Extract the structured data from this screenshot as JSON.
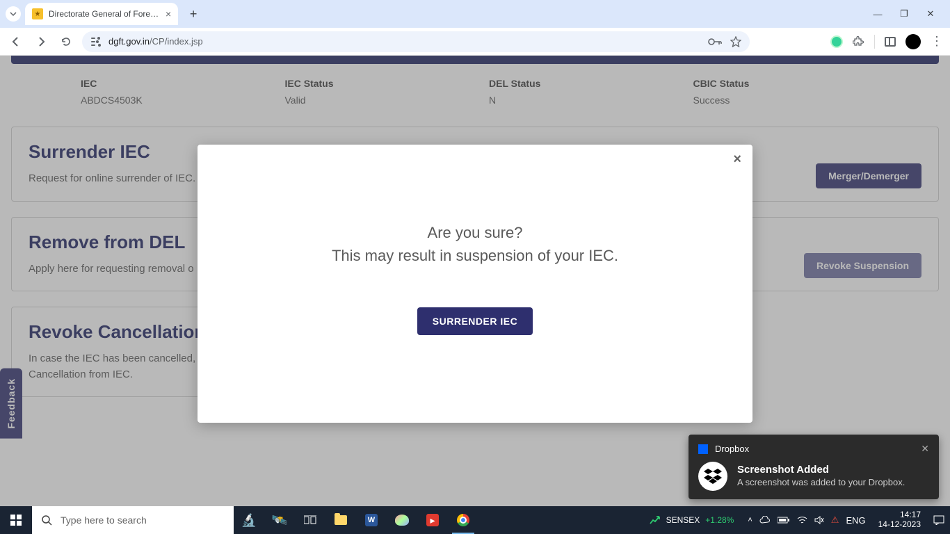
{
  "browser": {
    "tab_title": "Directorate General of Foreign",
    "url_host": "dgft.gov.in",
    "url_path": "/CP/index.jsp"
  },
  "info": {
    "iec_label": "IEC",
    "iec_value": "ABDCS4503K",
    "iec_status_label": "IEC Status",
    "iec_status_value": "Valid",
    "del_status_label": "DEL Status",
    "del_status_value": "N",
    "cbic_status_label": "CBIC Status",
    "cbic_status_value": "Success"
  },
  "cards": {
    "surrender": {
      "title": "Surrender IEC",
      "desc": "Request for online surrender of IEC. ... e can be recorded in the system will need to be revoked by filing revo",
      "button": "Merger/Demerger"
    },
    "remove_del": {
      "title": "Remove from DEL",
      "desc": "Apply here for requesting removal o ... this option to raise a request to for DGFT benefits and schemes agai",
      "button": "Revoke Suspension"
    },
    "revoke_cancel": {
      "title": "Revoke Cancellation",
      "desc": "In case the IEC has been cancelled, use this option to raise a request to revoke the Cancellation from IEC."
    }
  },
  "feedback": "Feedback",
  "modal": {
    "line1": "Are you sure?",
    "line2": "This may result in suspension of your IEC.",
    "confirm": "SURRENDER IEC"
  },
  "toast": {
    "app": "Dropbox",
    "title": "Screenshot Added",
    "desc": "A screenshot was added to your Dropbox."
  },
  "taskbar": {
    "search_placeholder": "Type here to search",
    "sensex_label": "SENSEX",
    "sensex_change": "+1.28%",
    "lang": "ENG",
    "time": "14:17",
    "date": "14-12-2023"
  }
}
